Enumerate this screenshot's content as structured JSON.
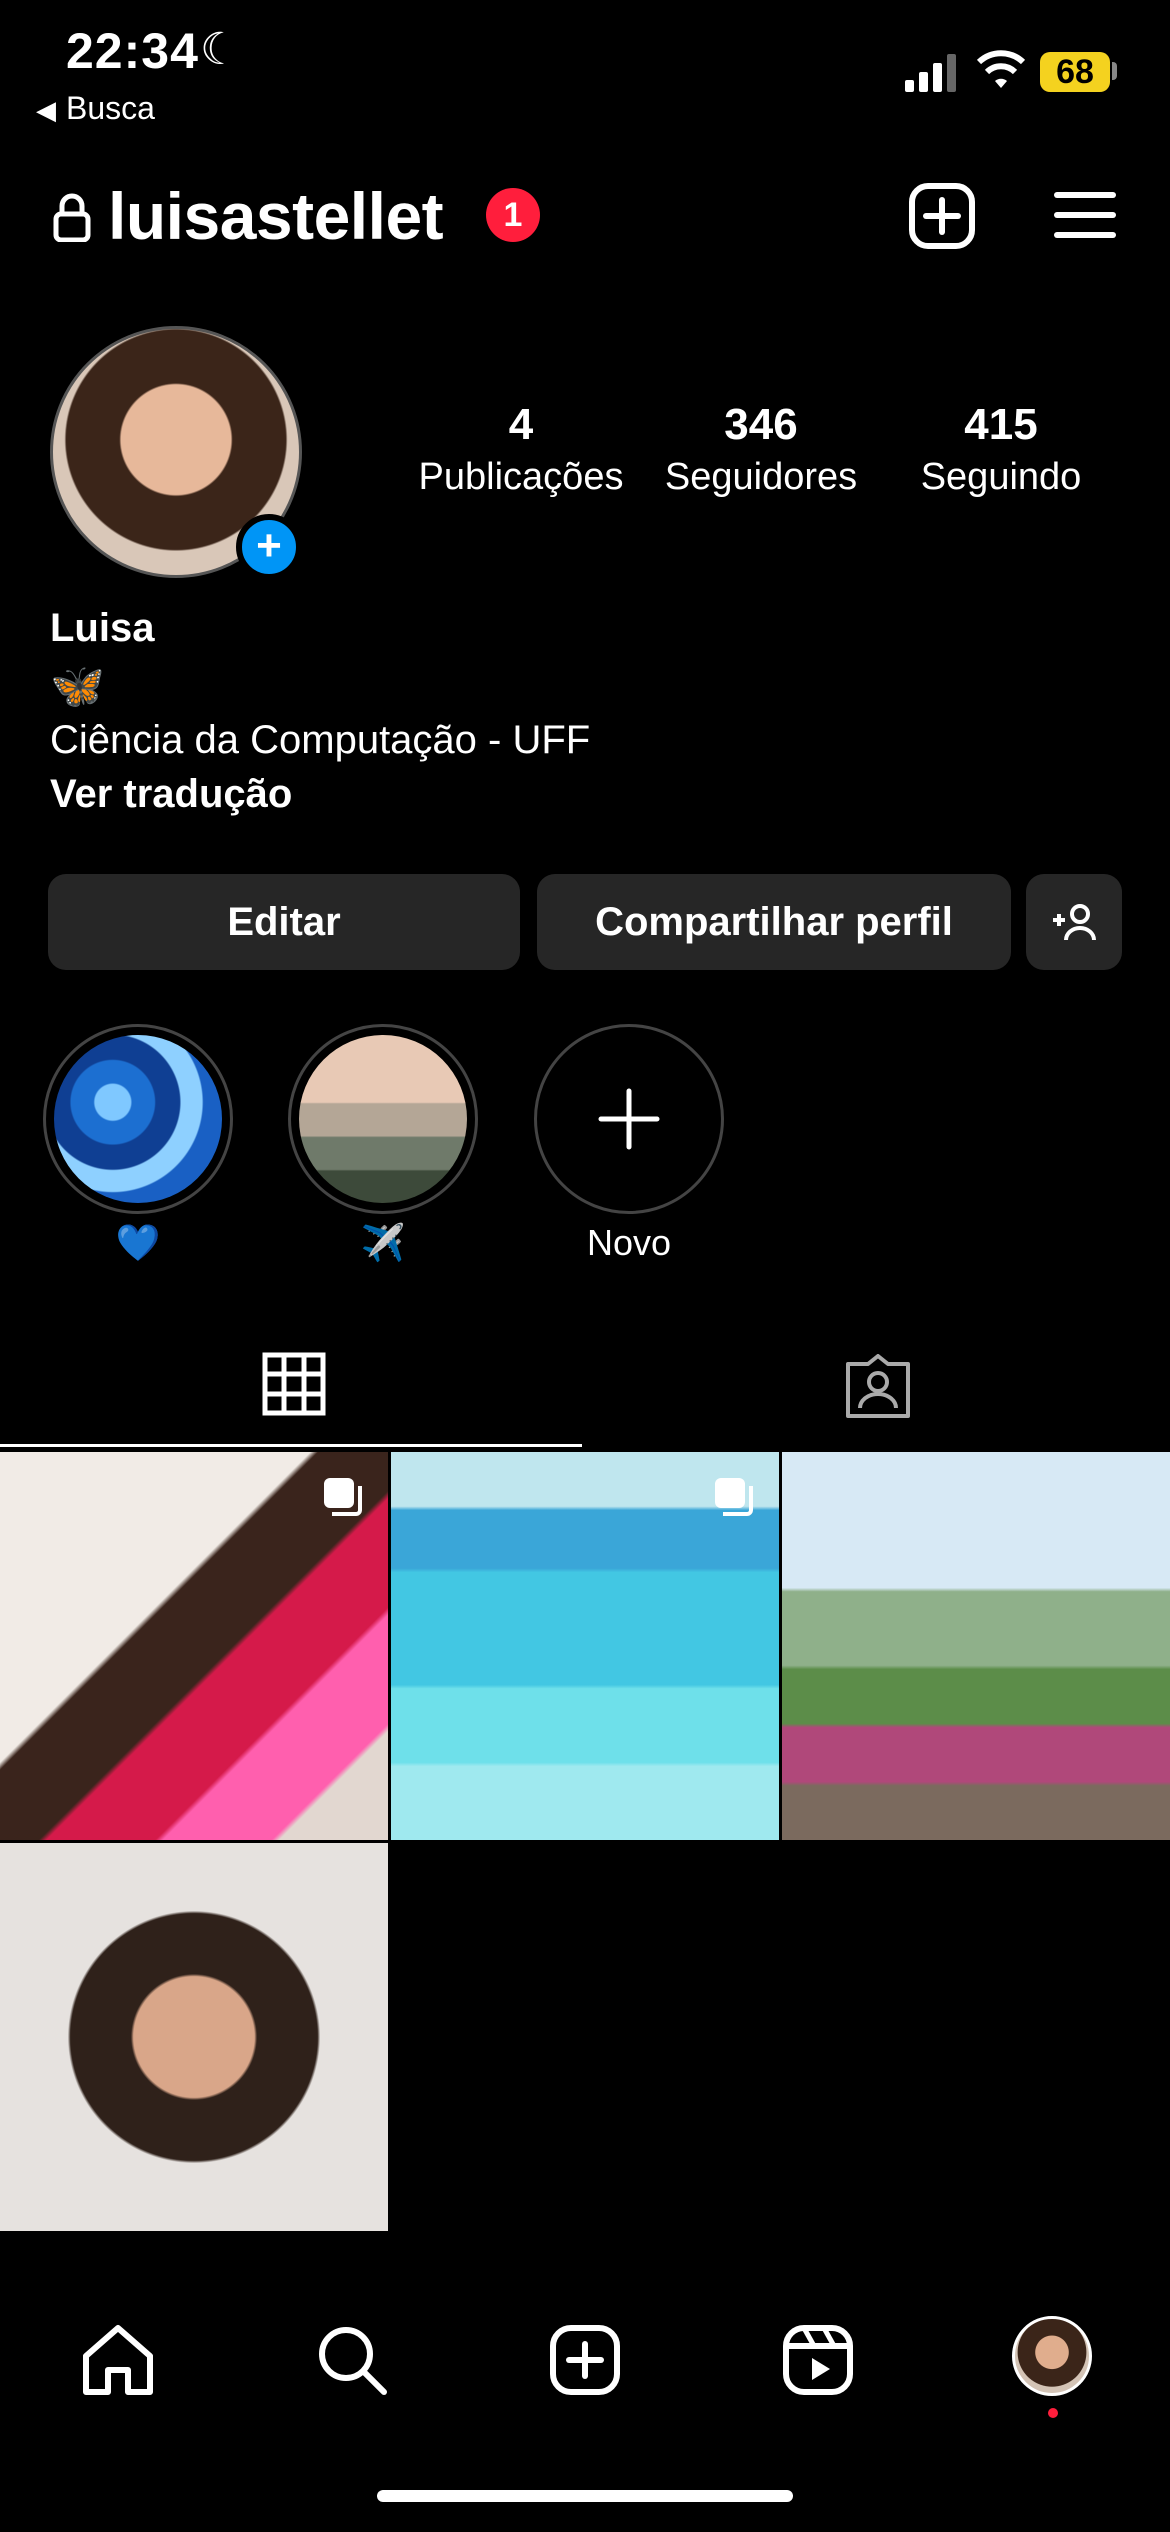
{
  "status_bar": {
    "time": "22:34",
    "back_label": "Busca",
    "battery": "68"
  },
  "header": {
    "username": "luisastellet",
    "notification_count": "1"
  },
  "stats": [
    {
      "value": "4",
      "label": "Publicações"
    },
    {
      "value": "346",
      "label": "Seguidores"
    },
    {
      "value": "415",
      "label": "Seguindo"
    }
  ],
  "bio": {
    "name": "Luisa",
    "emoji": "🦋",
    "line": "Ciência da Computação - UFF",
    "translate": "Ver tradução"
  },
  "buttons": {
    "edit": "Editar",
    "share": "Compartilhar perfil"
  },
  "highlights": [
    {
      "label": "💙"
    },
    {
      "label": "✈️"
    },
    {
      "label": "Novo"
    }
  ],
  "colors": {
    "background": "#000000",
    "accent_blue": "#0095f6",
    "badge_red": "#ff1e3c",
    "button_gray": "#262626"
  }
}
